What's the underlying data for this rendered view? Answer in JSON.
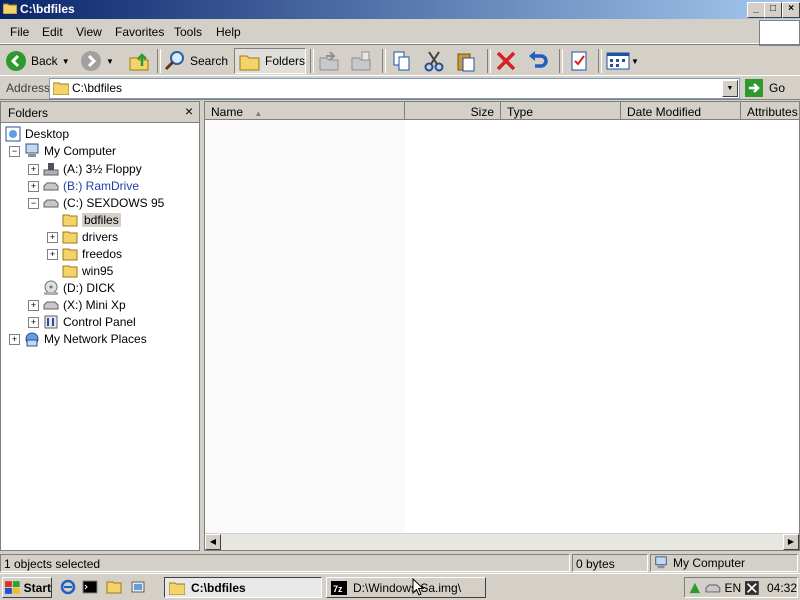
{
  "window": {
    "title": "C:\\bdfiles",
    "controls": {
      "minimize": "_",
      "maximize": "□",
      "close": "×"
    }
  },
  "menu": [
    "File",
    "Edit",
    "View",
    "Favorites",
    "Tools",
    "Help"
  ],
  "toolbar": {
    "back_label": "Back",
    "search_label": "Search",
    "folders_label": "Folders"
  },
  "address": {
    "label": "Address",
    "value": "C:\\bdfiles",
    "go_label": "Go"
  },
  "folders_pane": {
    "title": "Folders",
    "close": "×",
    "tree": [
      {
        "label": "Desktop",
        "icon": "desktop-icon"
      },
      {
        "label": "My Computer",
        "icon": "computer-icon",
        "expander": "−"
      },
      {
        "label": "(A:) 3½ Floppy",
        "icon": "floppy-drive-icon",
        "expander": "+"
      },
      {
        "label": "(B:) RamDrive",
        "icon": "drive-icon",
        "expander": "+"
      },
      {
        "label": "(C:) SEXDOWS 95",
        "icon": "drive-icon",
        "expander": "−"
      },
      {
        "label": "bdfiles",
        "icon": "folder-icon"
      },
      {
        "label": "drivers",
        "icon": "folder-icon",
        "expander": "+"
      },
      {
        "label": "freedos",
        "icon": "folder-icon",
        "expander": "+"
      },
      {
        "label": "win95",
        "icon": "folder-icon"
      },
      {
        "label": "(D:) DICK",
        "icon": "cd-drive-icon"
      },
      {
        "label": "(X:) Mini Xp",
        "icon": "drive-icon",
        "expander": "+"
      },
      {
        "label": "Control Panel",
        "icon": "control-panel-icon",
        "expander": "+"
      },
      {
        "label": "My Network Places",
        "icon": "network-icon",
        "expander": "+"
      }
    ]
  },
  "files_pane": {
    "columns": [
      "Name",
      "Size",
      "Type",
      "Date Modified",
      "Attributes"
    ],
    "sort_indicator": "▲"
  },
  "status": {
    "selection": "1 objects selected",
    "size": "0 bytes",
    "location": "My Computer"
  },
  "taskbar": {
    "start_label": "Start",
    "tasks": [
      {
        "label": "C:\\bdfiles",
        "active": true
      },
      {
        "label": "D:\\Windows\\Sa.img\\",
        "active": false
      }
    ],
    "tray": {
      "lang": "EN",
      "time": "04:32"
    }
  },
  "colors": {
    "title_gradient_start": "#0a246a",
    "title_gradient_end": "#a6caf0",
    "chrome": "#d4d0c8",
    "folder_yellow": "#f5d36b",
    "go_green": "#2e9a2e",
    "delete_red": "#d92020",
    "undo_blue": "#1e5fbf"
  }
}
